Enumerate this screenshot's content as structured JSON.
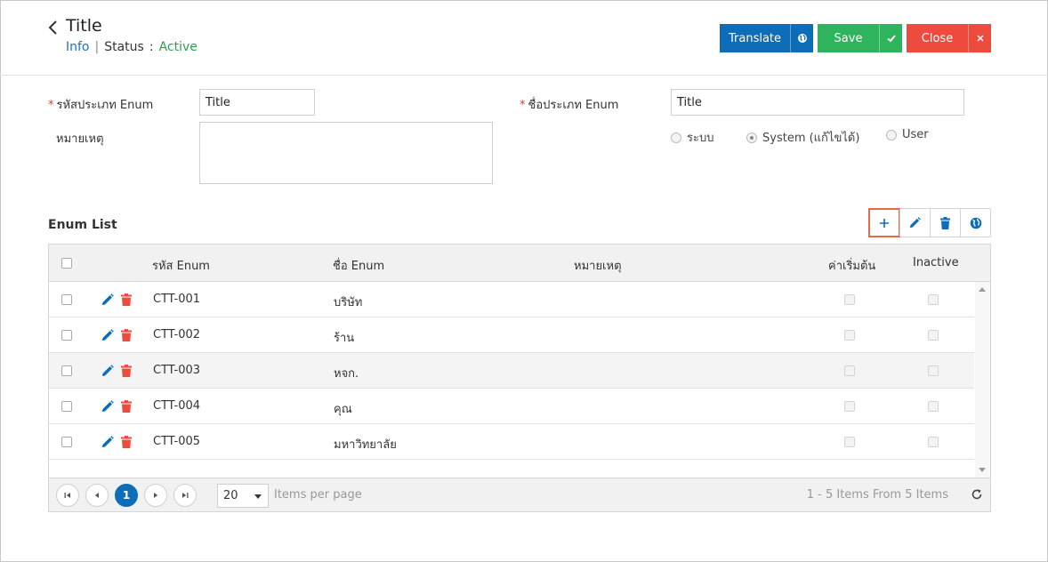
{
  "header": {
    "title": "Title",
    "info_link": "Info",
    "separator": "|",
    "status_label": "Status",
    "status_colon": ":",
    "status_value": "Active",
    "translate_label": "Translate",
    "save_label": "Save",
    "close_label": "Close"
  },
  "form": {
    "enum_code_label": "รหัสประเภท Enum",
    "enum_code_value": "Title",
    "enum_name_label": "ชื่อประเภท Enum",
    "enum_name_value": "Title",
    "remark_label": "หมายเหตุ",
    "remark_value": "",
    "required_mark": "*",
    "radio_options": [
      {
        "label": "ระบบ",
        "selected": false
      },
      {
        "label": "System (แก้ไขได้)",
        "selected": true
      },
      {
        "label": "User",
        "selected": false
      }
    ]
  },
  "enum_list": {
    "title": "Enum List",
    "columns": {
      "code": "รหัส Enum",
      "name": "ชื่อ Enum",
      "remark": "หมายเหตุ",
      "default": "ค่าเริ่มต้น",
      "inactive": "Inactive"
    },
    "rows": [
      {
        "code": "CTT-001",
        "name": "บริษัท",
        "remark": ""
      },
      {
        "code": "CTT-002",
        "name": "ร้าน",
        "remark": ""
      },
      {
        "code": "CTT-003",
        "name": "หจก.",
        "remark": ""
      },
      {
        "code": "CTT-004",
        "name": "คุณ",
        "remark": ""
      },
      {
        "code": "CTT-005",
        "name": "มหาวิทยาลัย",
        "remark": ""
      }
    ],
    "pager": {
      "current_page": "1",
      "page_size": "20",
      "items_per_page_label": "Items per page",
      "info": "1 - 5 Items From 5 Items"
    }
  },
  "colors": {
    "primary": "#0d6db8",
    "success": "#2eb45c",
    "danger": "#ec4b3d",
    "status_active": "#2e9e4f"
  },
  "icons": [
    "back-arrow-icon",
    "globe-icon",
    "check-icon",
    "close-icon",
    "plus-icon",
    "pencil-icon",
    "trash-icon",
    "refresh-icon",
    "first-page-icon",
    "prev-page-icon",
    "next-page-icon",
    "last-page-icon"
  ]
}
